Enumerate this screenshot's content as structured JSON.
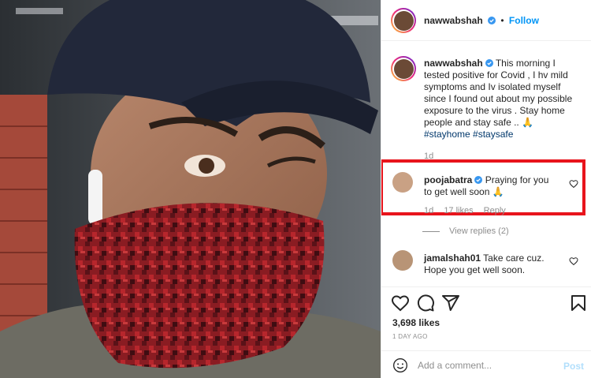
{
  "post": {
    "author": "nawwabshah",
    "follow_label": "Follow",
    "separator": "•",
    "verified_icon": "verified-badge-icon",
    "photo": {
      "description_icon": "post-photo"
    }
  },
  "caption": {
    "username": "nawwabshah",
    "text": "This morning I tested positive for Covid , I hv mild symptoms and Iv isolated myself since I found out about my possible exposure to the virus . Stay home people and stay safe .. 🙏",
    "hashtags": "#stayhome #staysafe",
    "time": "1d"
  },
  "comments": [
    {
      "username": "poojabatra",
      "text": "Praying for you to get well soon 🙏",
      "time": "1d",
      "likes": "17 likes",
      "reply_label": "Reply"
    },
    {
      "username": "jamalshah01",
      "text": "Take care cuz. Hope you get well soon."
    }
  ],
  "view_replies": "View replies (2)",
  "likes_count": "3,698 likes",
  "posted_ago": "1 DAY AGO",
  "add_comment": {
    "placeholder": "Add a comment...",
    "post_label": "Post"
  },
  "colors": {
    "accent": "#0095f6",
    "highlight": "#e8141c",
    "hashtag": "#00376b",
    "muted": "#8e8e8e"
  }
}
